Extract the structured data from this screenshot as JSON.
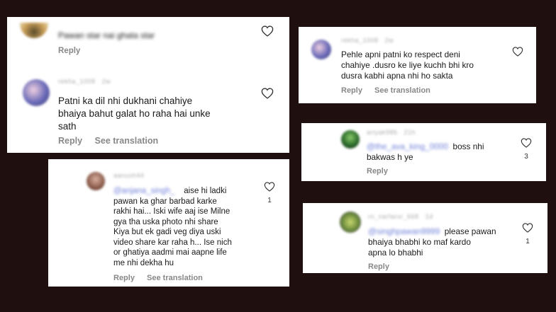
{
  "colors": {
    "background": "#1f0f0f",
    "card": "#ffffff",
    "mention": "#6f7fd8",
    "meta": "#888888"
  },
  "card1": {
    "top_comment": {
      "text": "Pawan star nai ghata star",
      "reply": "Reply"
    },
    "username": "rekha_1008",
    "time": "2w",
    "text_lines": [
      "Patni ka dil nhi dukhani chahiye",
      "bhaiya bahut galat ho raha hai unke",
      "sath"
    ],
    "reply": "Reply",
    "see_translation": "See translation"
  },
  "card2": {
    "username": "aanush44",
    "mention": "@anjana_singh_",
    "text_lines": [
      "aise hi ladki",
      "pawan ka ghar barbad karke",
      "rakhi hai... Iski wife aaj ise Milne",
      "gya tha uska photo nhi share",
      "Kiya but ek gadi veg diya uski",
      "video share kar raha h... Ise nich",
      "or ghatiya aadmi mai aapne life",
      "me nhi dekha hu"
    ],
    "likes": "1",
    "reply": "Reply",
    "see_translation": "See translation"
  },
  "card3": {
    "username": "rekha_1008",
    "time": "2w",
    "text_lines": [
      "Pehle apni patni ko respect deni",
      "chahiye .dusro ke liye kuchh bhi kro",
      "dusra kabhi apna nhi ho sakta"
    ],
    "reply": "Reply",
    "see_translation": "See translation"
  },
  "card4": {
    "username": "ariyak986",
    "time": "21h",
    "mention": "@the_ava_king_0000",
    "text_lines": [
      "boss nhi",
      "bakwas h ye"
    ],
    "likes": "3",
    "reply": "Reply"
  },
  "card5": {
    "username": "rn_narfarsr_668",
    "time": "1d",
    "mention": "@singhpawan9999",
    "text_lines": [
      "please pawan",
      "bhaiya bhabhi ko maf kardo",
      "apna lo bhabhi"
    ],
    "likes": "1",
    "reply": "Reply"
  }
}
